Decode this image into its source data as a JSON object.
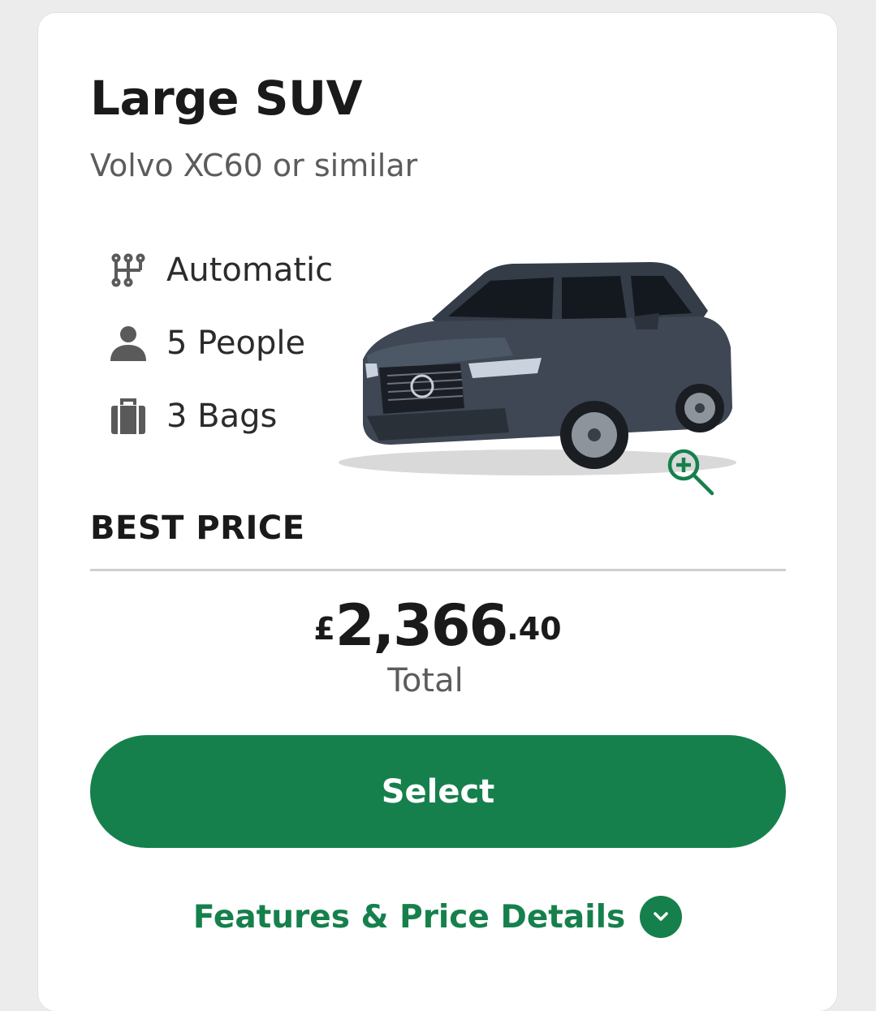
{
  "card": {
    "title": "Large SUV",
    "subtitle": "Volvo XC60 or similar",
    "features": [
      {
        "icon": "gear-shift-icon",
        "label": "Automatic"
      },
      {
        "icon": "person-icon",
        "label": "5 People"
      },
      {
        "icon": "luggage-icon",
        "label": "3 Bags"
      }
    ],
    "image": {
      "alt": "Volvo XC60 car image",
      "zoom_icon": "zoom-in-icon"
    },
    "price_label": "BEST PRICE",
    "price": {
      "currency": "£",
      "main": "2,366",
      "decimals": ".40"
    },
    "total_label": "Total",
    "select_label": "Select",
    "details_label": "Features & Price Details",
    "details_icon": "chevron-down-icon"
  },
  "colors": {
    "accent": "#16804d",
    "title": "#1a1a1a",
    "muted": "#5c5c5c",
    "background": "#ececec"
  }
}
